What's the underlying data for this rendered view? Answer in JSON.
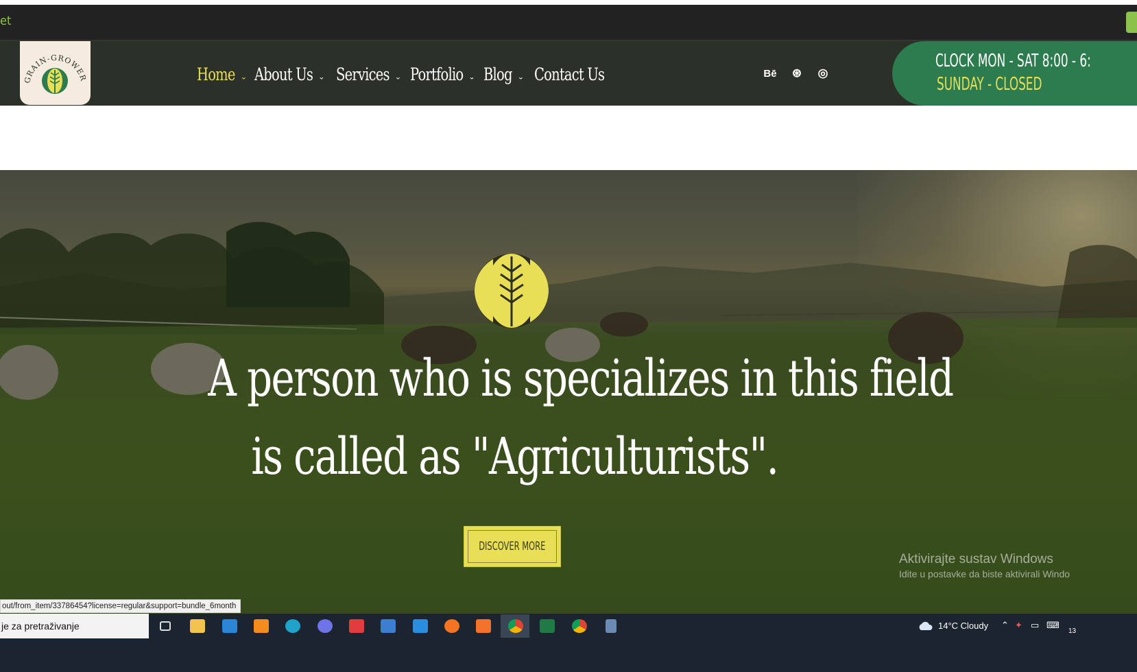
{
  "topbar": {
    "left_text": "et"
  },
  "logo": {
    "alt": "Grain-Grower",
    "arc_text": "GRAIN-GROWER"
  },
  "nav": {
    "items": [
      {
        "label": "Home",
        "active": true,
        "has_dropdown": true
      },
      {
        "label": "About Us",
        "active": false,
        "has_dropdown": true
      },
      {
        "label": "Services",
        "active": false,
        "has_dropdown": true
      },
      {
        "label": "Portfolio",
        "active": false,
        "has_dropdown": true
      },
      {
        "label": "Blog",
        "active": false,
        "has_dropdown": true
      },
      {
        "label": "Contact Us",
        "active": false,
        "has_dropdown": false
      }
    ],
    "chevron": "⌄"
  },
  "social": [
    {
      "icon": "behance-icon",
      "glyph": "Bē"
    },
    {
      "icon": "dribbble-icon",
      "glyph": "⊛"
    },
    {
      "icon": "instagram-icon",
      "glyph": "◎"
    }
  ],
  "hours": {
    "line1": "CLOCK  MON - SAT 8:00 - 6:",
    "line2": "SUNDAY - CLOSED"
  },
  "hero": {
    "title_line1": "A person who is specializes in this field",
    "title_line2": "is called as \"Agriculturists\".",
    "button_label": "DISCOVER MORE"
  },
  "windows_watermark": {
    "line1": "Aktivirajte sustav Windows",
    "line2": "Idite u postavke da biste aktivirali Windo"
  },
  "status_bar": {
    "url": "out/from_item/33786454?license=regular&support=bundle_6month"
  },
  "taskbar": {
    "search_text": "je za pretraživanje",
    "weather": "14°C  Cloudy",
    "clock_partial": "13",
    "apps": [
      "task-view-icon",
      "file-explorer-icon",
      "mail-icon",
      "sublime-text-icon",
      "edge-icon",
      "discord-icon",
      "anydesk-icon",
      "photos-icon",
      "vscode-icon",
      "avast-icon",
      "xampp-icon",
      "chrome-icon",
      "excel-icon",
      "chrome-profile-icon",
      "calculator-icon"
    ]
  },
  "colors": {
    "accent_yellow": "#e8df56",
    "header_bg": "#2b3128",
    "hours_green": "#2d7c4f",
    "topbar_green": "#8bc34a"
  }
}
